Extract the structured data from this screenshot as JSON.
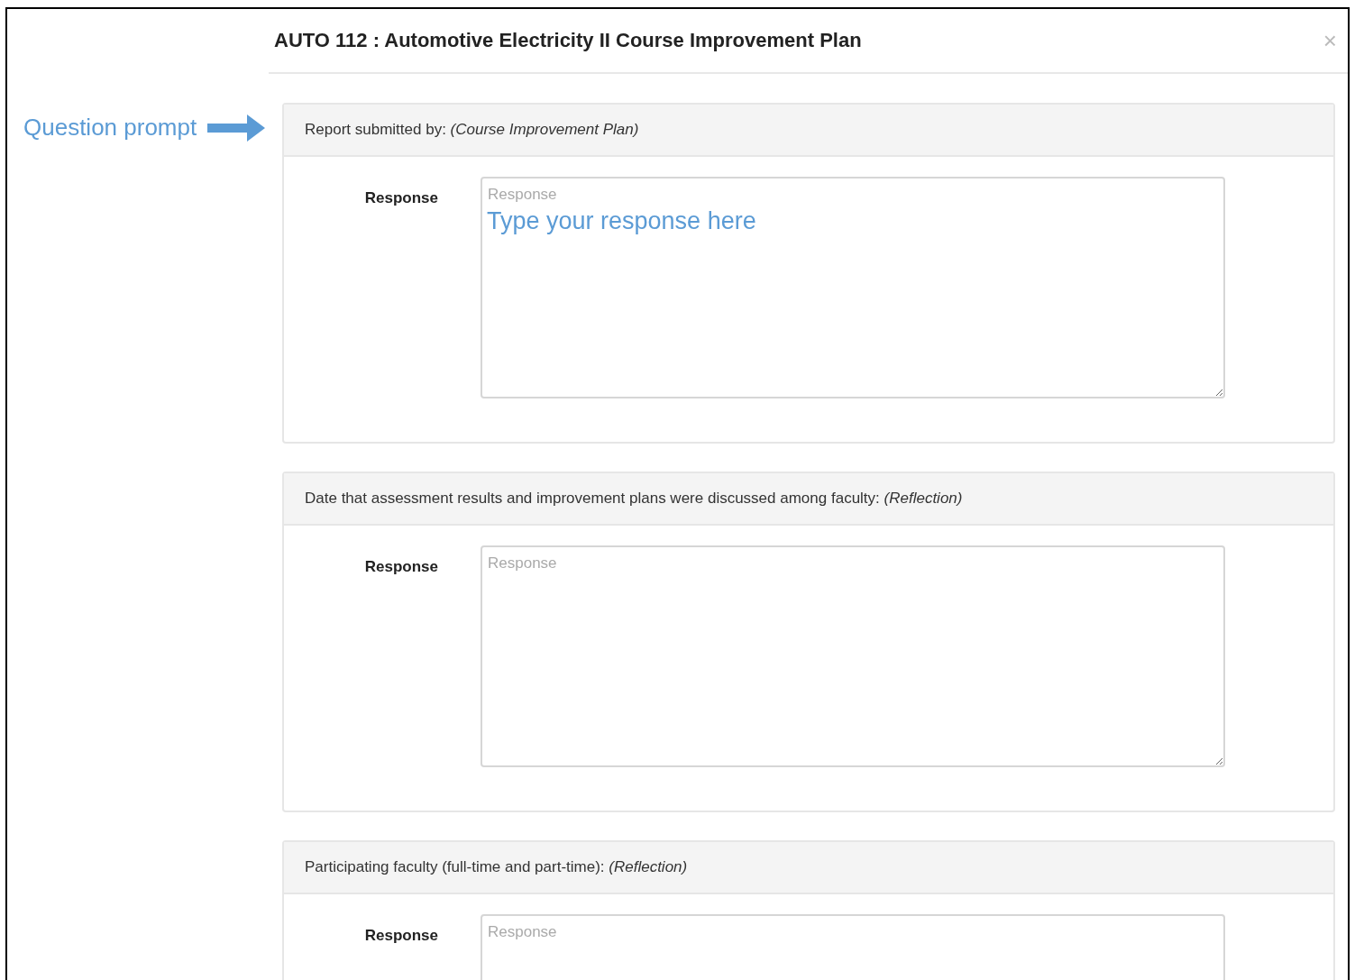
{
  "annotation": {
    "label": "Question prompt"
  },
  "dialog": {
    "title": "AUTO 112 : Automotive Electricity II Course Improvement Plan",
    "close": "×"
  },
  "questions": [
    {
      "prompt": "Report submitted by: *(Course Improvement Plan)*",
      "response_label": "Response",
      "placeholder": "Response",
      "annotation": "Type your response here"
    },
    {
      "prompt": "Date that assessment results and improvement plans were discussed among faculty: *(Reflection)*",
      "response_label": "Response",
      "placeholder": "Response"
    },
    {
      "prompt": "Participating faculty (full-time and part-time): *(Reflection)*",
      "response_label": "Response",
      "placeholder": "Response"
    }
  ]
}
